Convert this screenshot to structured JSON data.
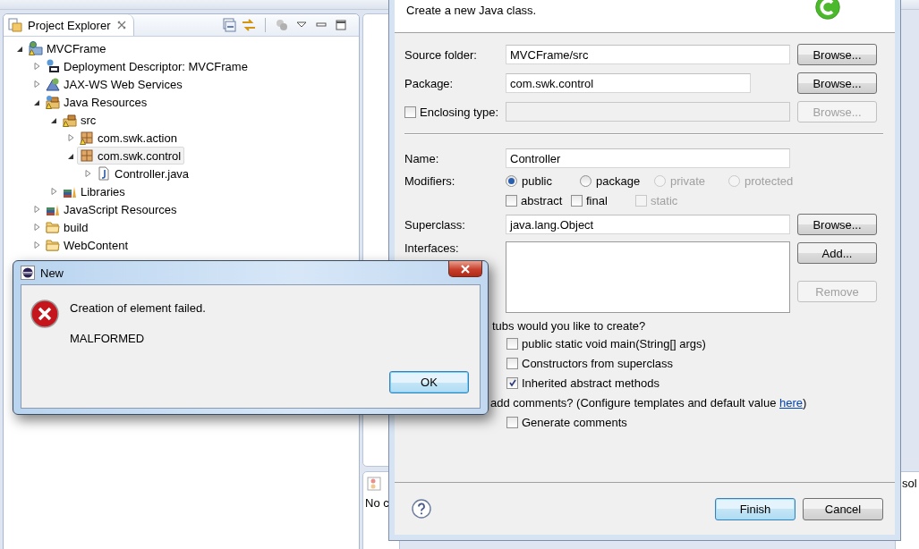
{
  "explorer": {
    "tab": {
      "label": "Project Explorer"
    },
    "tree": [
      {
        "label": "MVCFrame",
        "kind": "project",
        "warning": true,
        "expanded": true,
        "selected": false,
        "children": [
          {
            "label": "Deployment Descriptor: MVCFrame",
            "kind": "descriptor",
            "warning": false,
            "expanded": false,
            "selected": false
          },
          {
            "label": "JAX-WS Web Services",
            "kind": "webservice",
            "warning": false,
            "expanded": false,
            "selected": false
          },
          {
            "label": "Java Resources",
            "kind": "resources",
            "warning": true,
            "expanded": true,
            "selected": false,
            "children": [
              {
                "label": "src",
                "kind": "source",
                "warning": true,
                "expanded": true,
                "selected": false,
                "children": [
                  {
                    "label": "com.swk.action",
                    "kind": "package",
                    "warning": true,
                    "expanded": false,
                    "selected": false
                  },
                  {
                    "label": "com.swk.control",
                    "kind": "package",
                    "warning": false,
                    "expanded": true,
                    "selected": true,
                    "children": [
                      {
                        "label": "Controller.java",
                        "kind": "javafile",
                        "warning": false,
                        "expanded": false,
                        "selected": false
                      }
                    ]
                  }
                ]
              },
              {
                "label": "Libraries",
                "kind": "library",
                "warning": false,
                "expanded": false,
                "selected": false
              }
            ]
          },
          {
            "label": "JavaScript Resources",
            "kind": "library",
            "warning": false,
            "expanded": false,
            "selected": false
          },
          {
            "label": "build",
            "kind": "folder",
            "warning": false,
            "expanded": false,
            "selected": false
          },
          {
            "label": "WebContent",
            "kind": "folder",
            "warning": false,
            "expanded": false,
            "selected": false
          }
        ]
      }
    ]
  },
  "bottom_panel": {
    "text": "No c"
  },
  "right_panel": {
    "text": "sol"
  },
  "new_class_dialog": {
    "description": "Create a new Java class.",
    "source_folder": {
      "label": "Source folder:",
      "value": "MVCFrame/src",
      "button": "Browse..."
    },
    "package": {
      "label": "Package:",
      "value": "com.swk.control",
      "button": "Browse..."
    },
    "enclosing_type": {
      "label": "Enclosing type:",
      "checked": false,
      "disabled": true,
      "button": "Browse..."
    },
    "name": {
      "label": "Name:",
      "value": "Controller"
    },
    "modifiers": {
      "label": "Modifiers:",
      "radios": [
        {
          "label": "public",
          "selected": true,
          "disabled": false
        },
        {
          "label": "package",
          "selected": false,
          "disabled": false
        },
        {
          "label": "private",
          "selected": false,
          "disabled": true
        },
        {
          "label": "protected",
          "selected": false,
          "disabled": true
        }
      ],
      "checkboxes": [
        {
          "label": "abstract",
          "checked": false,
          "disabled": false
        },
        {
          "label": "final",
          "checked": false,
          "disabled": false
        },
        {
          "label": "static",
          "checked": false,
          "disabled": true
        }
      ]
    },
    "superclass": {
      "label": "Superclass:",
      "value": "java.lang.Object",
      "button": "Browse..."
    },
    "interfaces": {
      "label": "Interfaces:",
      "buttons": [
        {
          "label": "Add...",
          "disabled": false
        },
        {
          "label": "Remove",
          "disabled": true
        }
      ]
    },
    "stubs": {
      "question": "tubs would you like to create?",
      "options": [
        {
          "label": "public static void main(String[] args)",
          "checked": false
        },
        {
          "label": "Constructors from superclass",
          "checked": false
        },
        {
          "label": "Inherited abstract methods",
          "checked": true
        }
      ]
    },
    "comments": {
      "question_before": "add comments? (Configure templates and default value ",
      "link": "here",
      "question_after": ")",
      "options": [
        {
          "label": "Generate comments",
          "checked": false
        }
      ]
    },
    "footer_buttons": [
      {
        "label": "Finish",
        "default": true
      },
      {
        "label": "Cancel",
        "default": false
      }
    ]
  },
  "error_dialog": {
    "title": "New",
    "message": "Creation of element failed.",
    "detail": "MALFORMED",
    "button": "OK"
  }
}
